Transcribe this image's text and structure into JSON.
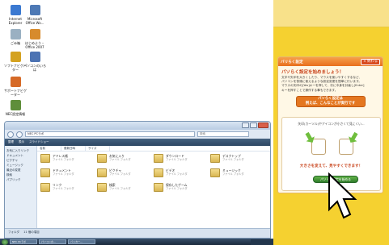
{
  "desktop": {
    "icons": [
      {
        "label": "Internet Explorer",
        "icon": "ie-icon",
        "color": "#3b79d1"
      },
      {
        "label": "Microsoft Office Wo...",
        "icon": "office-icon",
        "color": "#4e79b5"
      },
      {
        "label": "ごみ箱",
        "icon": "trash-icon",
        "color": "#9ab0c2"
      },
      {
        "label": "はじめよう・Office 2007",
        "icon": "office-start-icon",
        "color": "#d78b2c"
      },
      {
        "label": "ソフトナビゲーター",
        "icon": "navigator-icon",
        "color": "#d4a220"
      },
      {
        "label": "パソコンのいろは",
        "icon": "guide-icon",
        "color": "#4c73b3"
      },
      {
        "label": "サポートナビゲーター",
        "icon": "support-icon",
        "color": "#d66a27"
      },
      {
        "label": "NEC設定情報",
        "icon": "nec-icon",
        "color": "#5f8e3a"
      }
    ],
    "taskbar_items": [
      "NEC PCラボ",
      "パソコンの...",
      "バンカー..."
    ]
  },
  "explorer": {
    "address": "NEC PCラボ",
    "search_placeholder": "検索",
    "toolbar": [
      "整理",
      "表示",
      "スライドショー"
    ],
    "columns": [
      "名前",
      "更新日時",
      "サイズ"
    ],
    "nav_items": [
      "お気に入りリンク",
      "ドキュメント",
      "ピクチャ",
      "ミュージック",
      "最近の変更",
      "検索",
      "パブリック"
    ],
    "folders_label": "フォルダ",
    "items": [
      {
        "name": "アドレス帳",
        "sub": "ファイル フォルダ"
      },
      {
        "name": "お気に入り",
        "sub": "ファイル フォルダ"
      },
      {
        "name": "ダウンロード",
        "sub": "ファイル フォルダ"
      },
      {
        "name": "デスクトップ",
        "sub": "ファイル フォルダ"
      },
      {
        "name": "ドキュメント",
        "sub": "ファイル フォルダ"
      },
      {
        "name": "ピクチャ",
        "sub": "ファイル フォルダ"
      },
      {
        "name": "ビデオ",
        "sub": "ファイル フォルダ"
      },
      {
        "name": "ミュージック",
        "sub": "ファイル フォルダ"
      },
      {
        "name": "リンク",
        "sub": "ファイル フォルダ"
      },
      {
        "name": "検索",
        "sub": "ファイル フォルダ"
      },
      {
        "name": "保存したゲーム",
        "sub": "ファイル フォルダ"
      }
    ],
    "status": "11 個の項目"
  },
  "panel": {
    "title": "バリらく設定",
    "close_label": "× 終わる",
    "heading": "パソらく設定を始めましょう！",
    "desc_lines": [
      "文字や矢印を大きくしたり、マウスを使いやすくするなど、",
      "パソコンを快適に使えるような設定変更を簡単に行います。",
      "マウスの矢印の[Yes]キーを押して、次に中身を計画し[Enter]",
      "キーを押すことで操作する事もできます。"
    ],
    "banner_line1": "パソらく設定は",
    "banner_line2": "例えば、こんなことが実行です",
    "illustration_text": "矢印(カーソル)やアイコンが小さくて見にくい...",
    "caption": "大きさを変えて、見やすくできます！",
    "start_button": "パソらく設定を始める"
  },
  "colors": {
    "accent": "#e86f1d",
    "right_bg": "#f5d130",
    "start": "#2f7d2b"
  }
}
